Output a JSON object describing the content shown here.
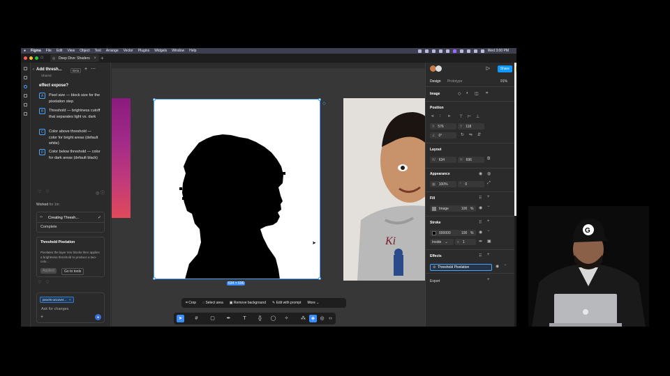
{
  "menubar": {
    "app": "Figma",
    "items": [
      "File",
      "Edit",
      "View",
      "Object",
      "Text",
      "Arrange",
      "Vector",
      "Plugins",
      "Widgets",
      "Window",
      "Help"
    ],
    "clock": "Wed 3:00 PM"
  },
  "tab": {
    "title": "Deep Dive: Shaders"
  },
  "assistant": {
    "title": "Add thresh...",
    "subtitle": "Shared",
    "beta": "Beta",
    "question": "effect expose?",
    "options": [
      {
        "key": "A",
        "text": "Pixel size — block size for the pixelation step"
      },
      {
        "key": "B",
        "text": "Threshold — brightness cutoff that separates light vs. dark"
      },
      {
        "key": "C",
        "text": "Color above threshold — color for bright areas (default white)"
      },
      {
        "key": "D",
        "text": "Color below threshold — color for dark areas (default black)"
      }
    ],
    "worked_label": "Worked",
    "worked_time": "for 1m",
    "task_title": "Creating Thresh...",
    "task_status": "Complete",
    "tool_title": "Threshold Pixelation",
    "tool_desc": "Pixelates the layer into blocks then applies a brightness threshold to produce a two-colo...",
    "applied_label": "Applied",
    "goto_label": "Go to tools",
    "chip_label": "pexels-uncover...",
    "input_placeholder": "Ask for changes"
  },
  "canvas": {
    "size_tag": "634 × 696",
    "context_toolbar": [
      "Crop",
      "Select area",
      "Remove background",
      "Edit with prompt",
      "More"
    ]
  },
  "design_panel": {
    "share_label": "Share",
    "tab_design": "Design",
    "tab_prototype": "Prototype",
    "zoom": "91%",
    "layer_type": "Image",
    "position_label": "Position",
    "x_label": "X",
    "x_value": "576",
    "y_label": "Y",
    "y_value": "118",
    "rotation_value": "0°",
    "layout_label": "Layout",
    "w_label": "W",
    "w_value": "634",
    "h_label": "H",
    "h_value": "696",
    "appearance_label": "Appearance",
    "opacity_value": "100%",
    "radius_value": "0",
    "fill_label": "Fill",
    "fill_type": "Image",
    "fill_opacity": "100",
    "fill_pct": "%",
    "stroke_label": "Stroke",
    "stroke_hex": "000000",
    "stroke_opacity": "100",
    "stroke_pct": "%",
    "stroke_position": "Inside",
    "stroke_weight": "1",
    "effects_label": "Effects",
    "effect_name": "Threshold Pixelation",
    "export_label": "Export"
  },
  "colors": {
    "accent": "#0d99ff",
    "selection": "#4da3ff"
  }
}
